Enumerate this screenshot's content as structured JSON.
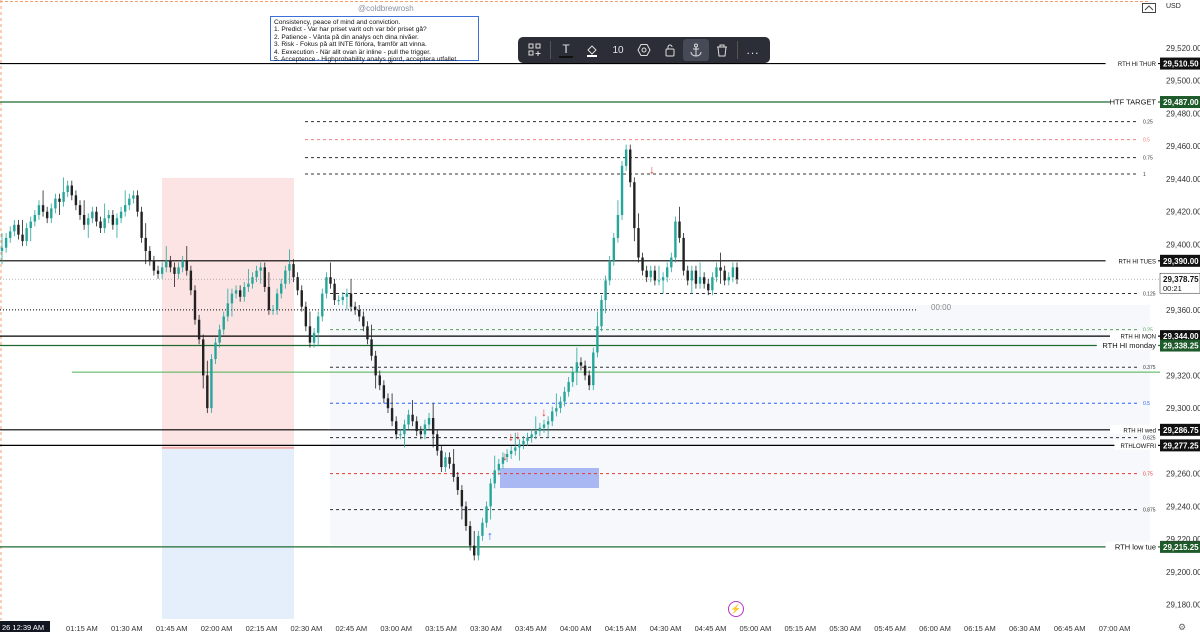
{
  "currency": "USD",
  "watermark": "@coldbrewrosh",
  "notes": [
    "Consistency, peace of mind and conviction.",
    "1. Predict - Var har priset varit och var bör priset gå?",
    "2. Patience - Vänta på din analys och dina nivåer.",
    "3. Risk - Fokus på att INTE förlora, framför att vinna.",
    "4. Eexecution - När allt ovan är inline - pull the trigger.",
    "5. Acceptence - Highprobability analys gjord, acceptera utfallet."
  ],
  "toolbar": {
    "items": [
      {
        "icon": "grid-plus-icon",
        "label": ""
      },
      {
        "icon": "text-tool-icon",
        "label": "T"
      },
      {
        "icon": "fill-bucket-icon",
        "label": ""
      },
      {
        "icon": "line-width-value",
        "label": "10"
      },
      {
        "icon": "settings-hex-icon",
        "label": ""
      },
      {
        "icon": "lock-icon",
        "label": ""
      },
      {
        "icon": "anchor-icon",
        "label": ""
      },
      {
        "icon": "trash-icon",
        "label": ""
      },
      {
        "icon": "more-icon",
        "label": "..."
      }
    ]
  },
  "countdown_label": "00:00",
  "day_flag": "26  12:39 AM",
  "chart_data": {
    "type": "candlestick",
    "title": "",
    "xlabel": "",
    "ylabel": "",
    "ylim": [
      29177,
      29535
    ],
    "x_ticks": [
      ":00 AM",
      "01:15 AM",
      "01:30 AM",
      "01:45 AM",
      "02:00 AM",
      "02:15 AM",
      "02:30 AM",
      "02:45 AM",
      "03:00 AM",
      "03:15 AM",
      "03:30 AM",
      "03:45 AM",
      "04:00 AM",
      "04:15 AM",
      "04:30 AM",
      "04:45 AM",
      "05:00 AM",
      "05:15 AM",
      "05:30 AM",
      "05:45 AM",
      "06:00 AM",
      "06:15 AM",
      "06:30 AM",
      "06:45 AM",
      "07:00 AM"
    ],
    "y_ticks": [
      "29,520.00",
      "29,500.00",
      "29,480.00",
      "29,460.00",
      "29,440.00",
      "29,420.00",
      "29,400.00",
      "29,360.00",
      "29,320.00",
      "29,300.00",
      "29,260.00",
      "29,240.00",
      "29,220.00",
      "29,200.00",
      "29,180.00"
    ],
    "y_tick_values": [
      29520,
      29500,
      29480,
      29460,
      29440,
      29420,
      29400,
      29360,
      29320,
      29300,
      29260,
      29240,
      29220,
      29200,
      29180
    ],
    "last_price": {
      "label": "29,378.75",
      "value": 29378.75,
      "timer": "00:21"
    },
    "key_levels": [
      {
        "name": "RTH HI THUR",
        "label": "29,510.50",
        "value": 29510.5,
        "color": "#000000",
        "style": "solid"
      },
      {
        "name": "HTF TARGET",
        "label": "29,487.00",
        "value": 29487.0,
        "color": "#1e6b30",
        "style": "solid"
      },
      {
        "name": "RTH HI TUES",
        "label": "29,390.00",
        "value": 29390.0,
        "color": "#000000",
        "style": "solid"
      },
      {
        "name": "RTH HI MON",
        "label": "29,344.00",
        "value": 29344.0,
        "color": "#000000",
        "style": "solid"
      },
      {
        "name": "RTH HI monday",
        "label": "29,338.25",
        "value": 29338.25,
        "color": "#1e6b30",
        "style": "solid"
      },
      {
        "name": "RTH HI wed",
        "label": "29,286.75",
        "value": 29286.75,
        "color": "#000000",
        "style": "solid"
      },
      {
        "name": "RTHLOWFRI",
        "label": "29,277.25",
        "value": 29277.25,
        "color": "#000000",
        "style": "solid"
      },
      {
        "name": "RTH low tue",
        "label": "29,215.25",
        "value": 29215.25,
        "color": "#1e6b30",
        "style": "solid"
      }
    ],
    "fib_levels": [
      {
        "label": "0.25",
        "value": 29475,
        "color": "#333333"
      },
      {
        "label": "0.5",
        "value": 29464,
        "color": "#f08080"
      },
      {
        "label": "0.75",
        "value": 29453,
        "color": "#333333"
      },
      {
        "label": "1",
        "value": 29443,
        "color": "#333333"
      },
      {
        "label": "0.125",
        "value": 29370,
        "color": "#333333"
      },
      {
        "label": "0.25",
        "value": 29348,
        "color": "#5aa05a"
      },
      {
        "label": "0.375",
        "value": 29325,
        "color": "#333333"
      },
      {
        "label": "0.5",
        "value": 29303,
        "color": "#2962ff"
      },
      {
        "label": "0.625",
        "value": 29282,
        "color": "#333333"
      },
      {
        "label": "0.75",
        "value": 29260,
        "color": "#e53935"
      },
      {
        "label": "0.875",
        "value": 29238,
        "color": "#333333"
      }
    ],
    "extra_lines": [
      {
        "value": 29360,
        "color": "#000000",
        "style": "dotted"
      },
      {
        "value": 29322,
        "color": "#4caf50",
        "style": "solid"
      }
    ],
    "closes": [
      29398,
      29404,
      29408,
      29412,
      29406,
      29402,
      29410,
      29414,
      29418,
      29424,
      29420,
      29416,
      29422,
      29428,
      29426,
      29432,
      29436,
      29430,
      29424,
      29418,
      29412,
      29416,
      29420,
      29414,
      29410,
      29416,
      29418,
      29412,
      29416,
      29420,
      29424,
      29428,
      29430,
      29420,
      29404,
      29396,
      29390,
      29384,
      29382,
      29386,
      29390,
      29386,
      29382,
      29386,
      29390,
      29384,
      29372,
      29354,
      29342,
      29320,
      29300,
      29330,
      29340,
      29348,
      29356,
      29364,
      29370,
      29372,
      29368,
      29374,
      29376,
      29380,
      29384,
      29386,
      29374,
      29360,
      29360,
      29370,
      29376,
      29384,
      29388,
      29380,
      29372,
      29362,
      29350,
      29340,
      29346,
      29356,
      29370,
      29380,
      29376,
      29366,
      29366,
      29368,
      29370,
      29362,
      29360,
      29356,
      29350,
      29342,
      29332,
      29320,
      29314,
      29306,
      29300,
      29292,
      29284,
      29284,
      29290,
      29296,
      29292,
      29286,
      29284,
      29290,
      29294,
      29284,
      29274,
      29264,
      29270,
      29266,
      29258,
      29250,
      29240,
      29228,
      29216,
      29210,
      29222,
      29230,
      29240,
      29254,
      29262,
      29266,
      29270,
      29272,
      29274,
      29276,
      29278,
      29280,
      29282,
      29284,
      29286,
      29288,
      29290,
      29292,
      29298,
      29300,
      29304,
      29310,
      29316,
      29322,
      29328,
      29326,
      29320,
      29314,
      29334,
      29350,
      29366,
      29378,
      29390,
      29404,
      29418,
      29448,
      29458,
      29438,
      29410,
      29392,
      29384,
      29380,
      29384,
      29378,
      29378,
      29380,
      29386,
      29392,
      29414,
      29404,
      29384,
      29378,
      29384,
      29376,
      29380,
      29376,
      29372,
      29380,
      29386,
      29384,
      29378,
      29380,
      29386,
      29378.75
    ],
    "markers": [
      {
        "kind": "sell",
        "label": "↓",
        "x": 652,
        "price": 29442
      },
      {
        "kind": "sell",
        "label": "↓",
        "x": 505,
        "price": 29267
      },
      {
        "kind": "sell",
        "label": "↓",
        "x": 511,
        "price": 29279
      },
      {
        "kind": "sell",
        "label": "↓",
        "x": 518,
        "price": 29280
      },
      {
        "kind": "sell",
        "label": "↓",
        "x": 544,
        "price": 29294
      },
      {
        "kind": "buy",
        "label": "↑",
        "x": 490,
        "price": 29226
      }
    ],
    "zones": [
      {
        "name": "pink-zone",
        "color": "#fde4e4"
      },
      {
        "name": "blue-zone",
        "color": "#e5effb"
      },
      {
        "name": "fvg-zone",
        "color": "#a9b8f3"
      }
    ]
  }
}
